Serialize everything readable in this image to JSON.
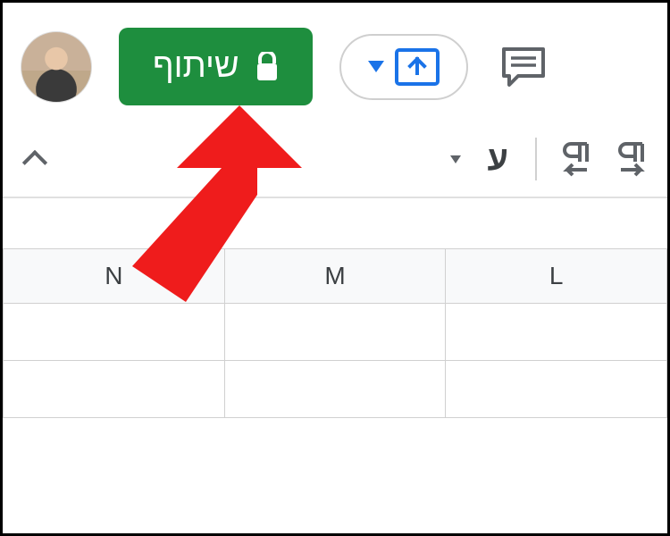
{
  "header": {
    "share_label": "שיתוף",
    "language_letter": "ע"
  },
  "columns": [
    "N",
    "M",
    "L"
  ]
}
